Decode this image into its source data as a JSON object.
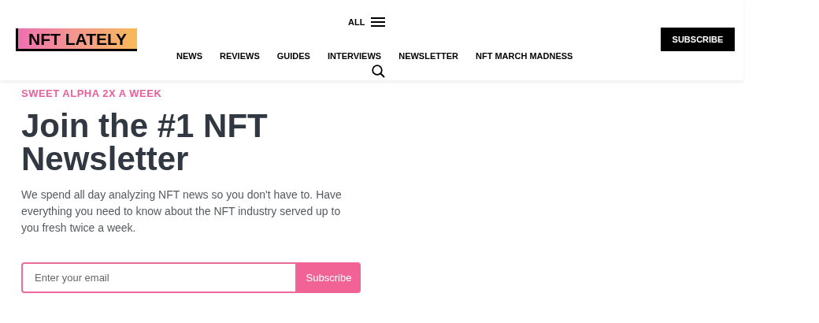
{
  "header": {
    "logo": "NFT LATELY",
    "menu_label": "ALL",
    "nav": [
      "NEWS",
      "REVIEWS",
      "GUIDES",
      "INTERVIEWS",
      "NEWSLETTER",
      "NFT MARCH MADNESS"
    ],
    "subscribe_button": "SUBSCRIBE"
  },
  "signup": {
    "eyebrow": "SWEET ALPHA 2X A WEEK",
    "heading": "Join the #1 NFT Newsletter",
    "description": "We spend all day analyzing NFT news so you don't have to. Have everything you need to know about the NFT industry served up to you fresh twice a week.",
    "email": {
      "placeholder": "Enter your email"
    },
    "button": "Subscribe"
  }
}
